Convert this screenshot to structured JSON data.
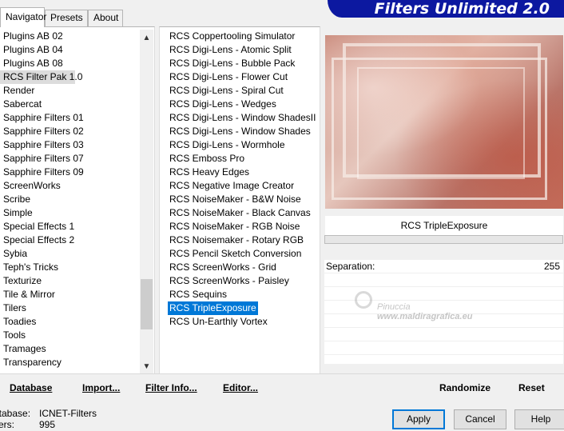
{
  "tabs": [
    "Navigator",
    "Presets",
    "About"
  ],
  "banner": "Filters Unlimited 2.0",
  "categories": [
    "Plugins AB 02",
    "Plugins AB 04",
    "Plugins AB 08",
    "RCS Filter Pak 1.0",
    "Render",
    "Sabercat",
    "Sapphire Filters 01",
    "Sapphire Filters 02",
    "Sapphire Filters 03",
    "Sapphire Filters 07",
    "Sapphire Filters 09",
    "ScreenWorks",
    "Scribe",
    "Simple",
    "Special Effects 1",
    "Special Effects 2",
    "Sybia",
    "Teph's Tricks",
    "Texturize",
    "Tile & Mirror",
    "Tilers",
    "Toadies",
    "Tools",
    "Tramages",
    "Transparency"
  ],
  "selected_category": "RCS Filter Pak 1.0",
  "filters": [
    "RCS Coppertooling Simulator",
    "RCS Digi-Lens - Atomic Split",
    "RCS Digi-Lens - Bubble Pack",
    "RCS Digi-Lens - Flower Cut",
    "RCS Digi-Lens - Spiral Cut",
    "RCS Digi-Lens - Wedges",
    "RCS Digi-Lens - Window ShadesII",
    "RCS Digi-Lens - Window Shades",
    "RCS Digi-Lens - Wormhole",
    "RCS Emboss Pro",
    "RCS Heavy Edges",
    "RCS Negative Image Creator",
    "RCS NoiseMaker - B&W Noise",
    "RCS NoiseMaker - Black Canvas",
    "RCS NoiseMaker - RGB Noise",
    "RCS Noisemaker - Rotary RGB",
    "RCS Pencil Sketch Conversion",
    "RCS ScreenWorks - Grid",
    "RCS ScreenWorks - Paisley",
    "RCS Sequins",
    "RCS TripleExposure",
    "RCS Un-Earthly Vortex"
  ],
  "selected_filter": "RCS TripleExposure",
  "filter_title": "RCS TripleExposure",
  "params": [
    {
      "label": "Separation:",
      "value": "255"
    }
  ],
  "watermark": {
    "line1": "Pinuccia",
    "line2": "www.maldiragrafica.eu"
  },
  "toolbar": {
    "database": "Database",
    "import": "Import...",
    "filter_info": "Filter Info...",
    "editor": "Editor...",
    "randomize": "Randomize",
    "reset": "Reset"
  },
  "status": {
    "database_label": "atabase:",
    "database_value": "ICNET-Filters",
    "filters_label": "lters:",
    "filters_value": "995"
  },
  "buttons": {
    "apply": "Apply",
    "cancel": "Cancel",
    "help": "Help"
  },
  "colors": {
    "banner": "#0c18a0",
    "selection": "#0078d7"
  }
}
